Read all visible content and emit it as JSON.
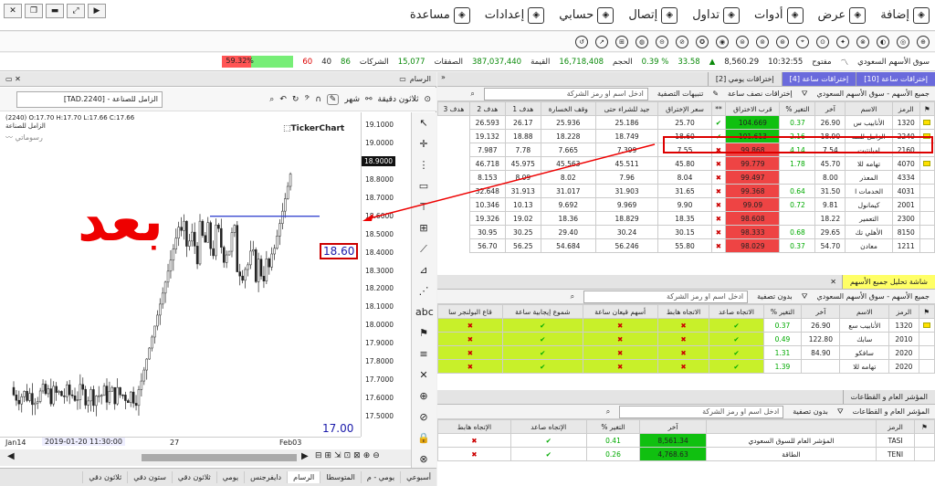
{
  "menu": [
    {
      "label": "إضافة",
      "icon": "add-icon"
    },
    {
      "label": "عرض",
      "icon": "view-icon"
    },
    {
      "label": "أدوات",
      "icon": "tools-icon"
    },
    {
      "label": "تداول",
      "icon": "cart-icon"
    },
    {
      "label": "إتصال",
      "icon": "phone-icon"
    },
    {
      "label": "حسابي",
      "icon": "user-icon"
    },
    {
      "label": "إعدادات",
      "icon": "gear-icon"
    },
    {
      "label": "مساعدة",
      "icon": "help-icon"
    }
  ],
  "status": {
    "market": "سوق الأسهم السعودي",
    "state": "مفتوح",
    "time": "10:32:55",
    "index": "8,560.29",
    "change": "33.58",
    "pct": "0.39 %",
    "volume_label": "الحجم",
    "volume": "16,718,408",
    "value_label": "القيمة",
    "value": "387,037,440",
    "trades_label": "الصفقات",
    "trades": "15,077",
    "companies_label": "الشركات",
    "up": "86",
    "flat": "40",
    "down": "60",
    "progress": "59.32%"
  },
  "chart": {
    "title": "الرسام",
    "symbol_search": "[TAD.2240] - الزامل للصناعة",
    "period": "ثلاثون دقيقة",
    "view": "شهر",
    "ohlc": "(2240) O:17.70 H:17.70 L:17.66 C:17.66",
    "name": "الزامل للصناعة",
    "indicator": "رسوماتي",
    "brand": "TickerChart",
    "annotation": "بعد",
    "last_price": "18.9000",
    "line_label": "18.60",
    "bottom_label": "17.00",
    "cursor_time": "2019-01-20 11:30:00",
    "time_labels": [
      "Jan14",
      "27",
      "Feb03"
    ],
    "price_ticks": [
      "19.1000",
      "19.0000",
      "18.9000",
      "18.8000",
      "18.7000",
      "18.6000",
      "18.5000",
      "18.4000",
      "18.3000",
      "18.2000",
      "18.1000",
      "18.0000",
      "17.9000",
      "17.8000",
      "17.7000",
      "17.6000",
      "17.5000"
    ],
    "bottom_tabs": [
      "أسبوعي",
      "يومي - م",
      "المتوسطا",
      "الرسام",
      "دايفرجنس",
      "يومي",
      "ثلاثون دقي",
      "ستون دقي",
      "ثلاثون دقي"
    ]
  },
  "p1": {
    "tabs": [
      "إختراقات ساعة [10]",
      "إختراقات ساعة [4]",
      "إختراقات يومي [2]"
    ],
    "market": "جميع الأسهم - سوق الأسهم السعودي",
    "filter": "إختراقات نصف ساعة",
    "alerts": "تنبيهات التصفية",
    "search_ph": "ادخل اسم او رمز الشركة",
    "headers": [
      "الرمز",
      "الاسم",
      "آخر",
      "التغير %",
      "قرب الاختراق",
      "**",
      "سعر الإختراق",
      "جيد للشراء حتى",
      "وقف الخسارة",
      "هدف 1",
      "هدف 2",
      "هدف 3"
    ],
    "rows": [
      [
        "1320",
        "الأنابيب س",
        "26.90",
        "0.37",
        "104.669",
        "ok",
        "25.70",
        "25.186",
        "25.936",
        "26.17",
        "26.593"
      ],
      [
        "2240",
        "الزامل للصـ",
        "18.90",
        "2.16",
        "101.613",
        "ok",
        "18.60",
        "18.749",
        "18.228",
        "18.88",
        "19.132"
      ],
      [
        "2160",
        "اميانتيت",
        "7.54",
        "4.14",
        "99.868",
        "no",
        "7.55",
        "7.399",
        "7.665",
        "7.78",
        "7.987"
      ],
      [
        "4070",
        "تهامه للا",
        "45.70",
        "1.78",
        "99.779",
        "no",
        "45.80",
        "45.511",
        "45.563",
        "45.975",
        "46.718"
      ],
      [
        "4334",
        "المعذر",
        "8.00",
        "",
        "99.497",
        "no",
        "8.04",
        "7.96",
        "8.02",
        "8.09",
        "8.153"
      ],
      [
        "4031",
        "الخدمات ا",
        "31.50",
        "0.64",
        "99.368",
        "no",
        "31.65",
        "31.903",
        "31.017",
        "31.913",
        "32.648"
      ],
      [
        "2001",
        "كيمانول",
        "9.81",
        "0.72",
        "99.09",
        "no",
        "9.90",
        "9.969",
        "9.692",
        "10.13",
        "10.346"
      ],
      [
        "2300",
        "التعمير",
        "18.22",
        "",
        "98.608",
        "no",
        "18.35",
        "18.829",
        "18.36",
        "19.02",
        "19.326"
      ],
      [
        "8150",
        "الأهلي تك",
        "29.65",
        "0.68",
        "98.333",
        "no",
        "30.15",
        "30.24",
        "29.40",
        "30.25",
        "30.95"
      ],
      [
        "1211",
        "معادن",
        "54.70",
        "0.37",
        "98.029",
        "no",
        "55.80",
        "56.246",
        "54.684",
        "56.25",
        "56.70"
      ]
    ]
  },
  "p2": {
    "tab": "شاشة تحليل جميع الأسهم",
    "market": "جميع الأسهم - سوق الأسهم السعودي",
    "filter": "بدون تصفية",
    "search_ph": "ادخل اسم او رمز الشركة",
    "headers": [
      "الرمز",
      "الاسم",
      "آخر",
      "التغير %",
      "الاتجاه صاعد",
      "الاتجاه هابط",
      "أسهم قيعان ساعة",
      "شموع إيجابية ساعة",
      "قاع البولنجر سا"
    ],
    "rows": [
      [
        "1320",
        "الأنابيب سع",
        "26.90",
        "0.37"
      ],
      [
        "2010",
        "سابك",
        "122.80",
        "0.49"
      ],
      [
        "2020",
        "سافكو",
        "84.90",
        "1.31"
      ],
      [
        "2020",
        "تهامه للا",
        "",
        "1.39"
      ]
    ]
  },
  "p3": {
    "tab": "المؤشر العام و القطاعات",
    "market": "المؤشر العام و القطاعات",
    "filter": "بدون تصفية",
    "search_ph": "ادخل اسم او رمز الشركة",
    "headers": [
      "الرمز",
      "",
      "آخر",
      "التغير %",
      "الإتجاه صاعد",
      "الإتجاه هابط"
    ],
    "rows": [
      [
        "TASI",
        "المؤشر العام للسوق السعودي",
        "8,561.34",
        "0.41"
      ],
      [
        "TENI",
        "الطاقة",
        "4,768.63",
        "0.26"
      ]
    ]
  }
}
